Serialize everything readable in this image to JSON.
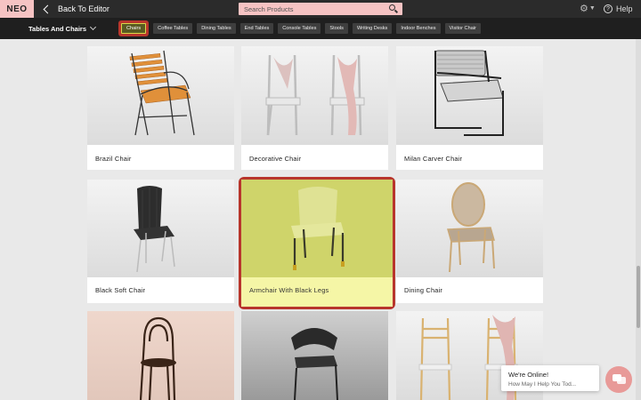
{
  "topbar": {
    "logo": "NEO",
    "back_label": "Back To Editor",
    "search_placeholder": "Search Products",
    "help_label": "Help"
  },
  "category": {
    "title": "Tables And Chairs",
    "chips": [
      "Chairs",
      "Coffee Tables",
      "Dining Tables",
      "End Tables",
      "Console Tables",
      "Stools",
      "Writing Desks",
      "Indoor Benches",
      "Visitor Chair"
    ],
    "active": "Chairs"
  },
  "products": [
    {
      "name": "Brazil Chair"
    },
    {
      "name": "Decorative Chair"
    },
    {
      "name": "Milan Carver Chair"
    },
    {
      "name": "Black Soft Chair"
    },
    {
      "name": "Armchair With Black Legs"
    },
    {
      "name": "Dining Chair"
    },
    {
      "name": ""
    },
    {
      "name": ""
    },
    {
      "name": ""
    }
  ],
  "chat": {
    "title": "We're Online!",
    "subtitle": "How May I Help You Tod..."
  },
  "colors": {
    "highlight_border": "#b8352c",
    "highlight_fill": "#cfd46a",
    "logo_bg": "#f6c3c3"
  }
}
